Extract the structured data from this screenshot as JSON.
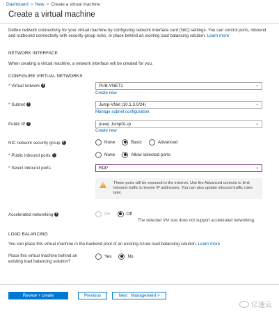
{
  "breadcrumb": {
    "items": [
      "Dashboard",
      "New",
      "Create a virtual machine"
    ],
    "separator": ">"
  },
  "page_title": "Create a virtual machine",
  "description": {
    "text": "Define network connectivity for your virtual machine by configuring network interface card (NIC) settings. You can control ports, inbound and outbound connectivity with security group rules, or place behind an existing load balancing solution.",
    "learn_more": "Learn more"
  },
  "network_interface": {
    "heading": "NETWORK INTERFACE",
    "note": "When creating a virtual machine, a network interface will be created for you."
  },
  "configure_vnets": {
    "heading": "CONFIGURE VIRTUAL NETWORKS",
    "virtual_network": {
      "label": "Virtual network",
      "value": "PUB-VNET1",
      "link": "Create new"
    },
    "subnet": {
      "label": "Subnet",
      "value": "Jump-VNet (10.1.3.0/24)",
      "link": "Manage subnet configuration"
    },
    "public_ip": {
      "label": "Public IP",
      "value": "(new) Jump01-ip",
      "link": "Create new"
    },
    "nsg": {
      "label": "NIC network security group",
      "options": [
        "None",
        "Basic",
        "Advanced"
      ],
      "selected": "Basic"
    },
    "inbound_ports": {
      "label": "Public inbound ports",
      "options": [
        "None",
        "Allow selected ports"
      ],
      "selected": "Allow selected ports"
    },
    "select_ports": {
      "label": "Select inbound ports",
      "value": "RDP"
    },
    "warning": "These ports will be exposed to the internet. Use the Advanced controls to limit inbound traffic to known IP addresses. You can also update inbound traffic rules later."
  },
  "accelerated": {
    "label": "Accelerated networking",
    "options": [
      "On",
      "Off"
    ],
    "selected": "Off",
    "note": "The selected VM size does not support accelerated networking."
  },
  "load_balancing": {
    "heading": "LOAD BALANCING",
    "note": "You can place this virtual machine in the backend pool of an existing Azure load balancing solution.",
    "learn_more": "Learn more",
    "question": "Place this virtual machine behind an existing load balancing solution?",
    "options": [
      "Yes",
      "No"
    ],
    "selected": "No"
  },
  "footer": {
    "review_create": "Review + create",
    "previous": "Previous",
    "next": "Next : Management >"
  },
  "watermark": "亿速云",
  "colors": {
    "primary": "#0078d4",
    "link": "#0063b1",
    "warning": "#e8a33d",
    "focus_border": "#7a3a8a"
  }
}
